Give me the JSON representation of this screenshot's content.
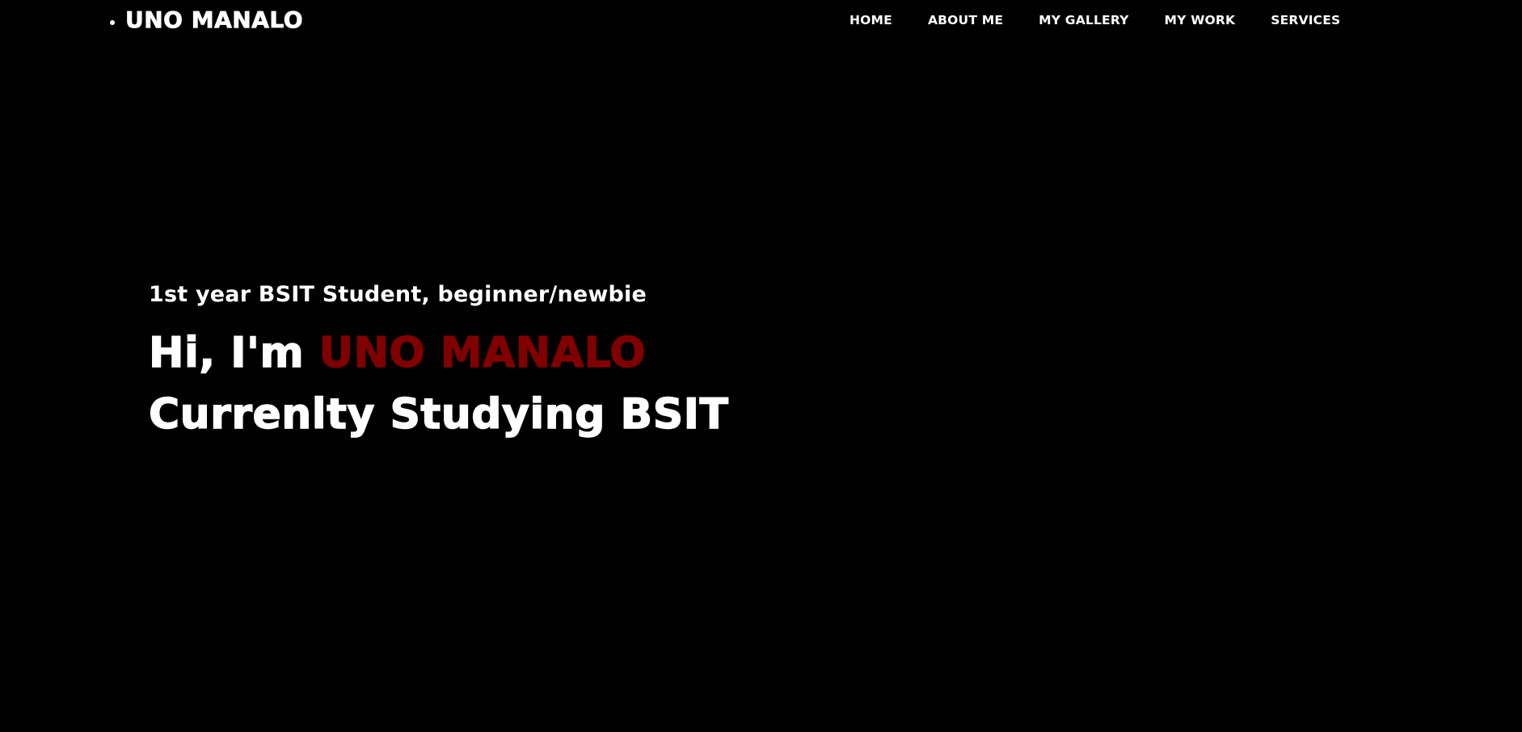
{
  "header": {
    "brand": "UNO MANALO",
    "nav": [
      {
        "label": "HOME"
      },
      {
        "label": "ABOUT ME"
      },
      {
        "label": "MY GALLERY"
      },
      {
        "label": "MY WORK"
      },
      {
        "label": "SERVICES"
      }
    ]
  },
  "hero": {
    "subtitle": "1st year BSIT Student, beginner/newbie",
    "greeting": "Hi, I'm",
    "name": "UNO MANALO",
    "tagline": "Currenlty Studying BSIT"
  },
  "colors": {
    "background": "#000000",
    "text": "#ffffff",
    "accent": "#800000"
  }
}
